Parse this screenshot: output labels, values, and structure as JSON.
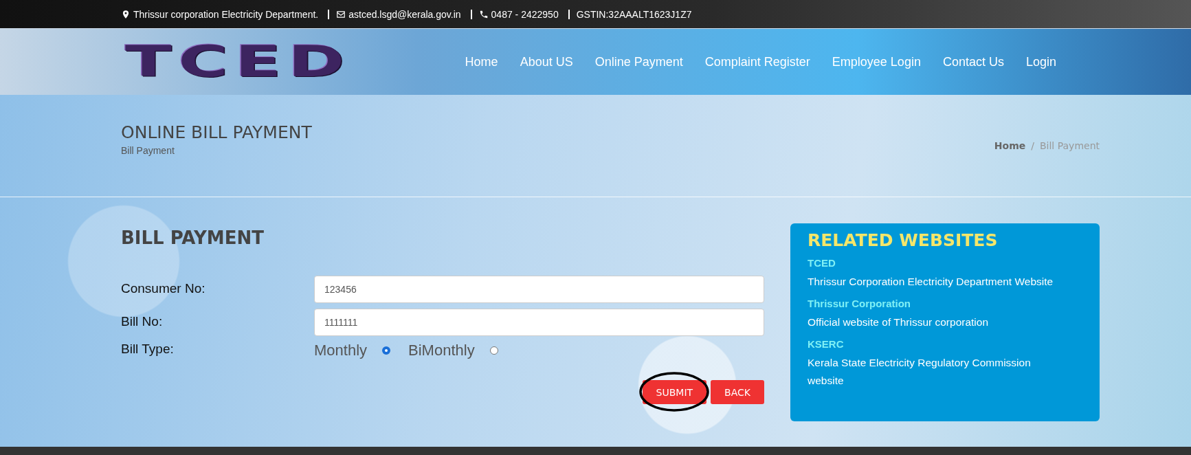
{
  "top_bar": {
    "address": "Thrissur corporation Electricity Department.",
    "email": "astced.lsgd@kerala.gov.in",
    "phone": "0487 - 2422950",
    "gstin": "GSTIN:32AAALT1623J1Z7"
  },
  "logo": "TCED",
  "nav": [
    {
      "label": "Home"
    },
    {
      "label": "About US"
    },
    {
      "label": "Online Payment"
    },
    {
      "label": "Complaint Register"
    },
    {
      "label": "Employee Login"
    },
    {
      "label": "Contact Us"
    },
    {
      "label": "Login"
    }
  ],
  "page_title": {
    "title": "ONLINE BILL PAYMENT",
    "subtitle": "Bill Payment"
  },
  "breadcrumb": [
    {
      "label": "Home",
      "selected": false
    },
    {
      "label": "Bill Payment",
      "selected": true
    }
  ],
  "breadcrumb_separator": "/",
  "form": {
    "title": "BILL PAYMENT",
    "fields": [
      {
        "label": "Consumer No:",
        "value": "123456"
      },
      {
        "label": "Bill No:",
        "value": "1111111"
      }
    ],
    "bill_type": {
      "label": "Bill Type:",
      "options": [
        {
          "label": "Monthly",
          "selected": true
        },
        {
          "label": "BiMonthly",
          "selected": false
        }
      ]
    },
    "buttons": [
      {
        "label": "SUBMIT",
        "circled": true
      },
      {
        "label": "BACK",
        "circled": false
      }
    ]
  },
  "related": {
    "title": "RELATED WEBSITES",
    "items": [
      {
        "name": "TCED",
        "description": "Thrissur Corporation Electricity Department Website"
      },
      {
        "name": "Thrissur Corporation",
        "description": "Official website of Thrissur corporation"
      },
      {
        "name": "KSERC",
        "description": "Kerala State Electricity Regulatory Commission website"
      }
    ]
  }
}
